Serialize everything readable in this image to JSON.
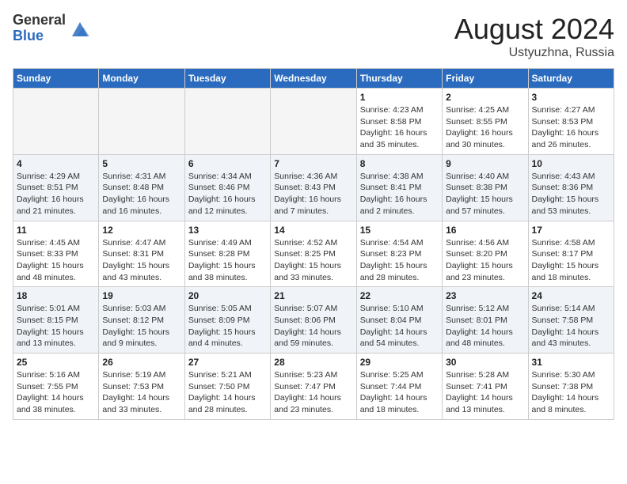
{
  "header": {
    "logo_general": "General",
    "logo_blue": "Blue",
    "month_year": "August 2024",
    "location": "Ustyuzhna, Russia"
  },
  "weekdays": [
    "Sunday",
    "Monday",
    "Tuesday",
    "Wednesday",
    "Thursday",
    "Friday",
    "Saturday"
  ],
  "weeks": [
    [
      {
        "day": "",
        "sunrise": "",
        "sunset": "",
        "daylight": ""
      },
      {
        "day": "",
        "sunrise": "",
        "sunset": "",
        "daylight": ""
      },
      {
        "day": "",
        "sunrise": "",
        "sunset": "",
        "daylight": ""
      },
      {
        "day": "",
        "sunrise": "",
        "sunset": "",
        "daylight": ""
      },
      {
        "day": "1",
        "sunrise": "Sunrise: 4:23 AM",
        "sunset": "Sunset: 8:58 PM",
        "daylight": "Daylight: 16 hours and 35 minutes."
      },
      {
        "day": "2",
        "sunrise": "Sunrise: 4:25 AM",
        "sunset": "Sunset: 8:55 PM",
        "daylight": "Daylight: 16 hours and 30 minutes."
      },
      {
        "day": "3",
        "sunrise": "Sunrise: 4:27 AM",
        "sunset": "Sunset: 8:53 PM",
        "daylight": "Daylight: 16 hours and 26 minutes."
      }
    ],
    [
      {
        "day": "4",
        "sunrise": "Sunrise: 4:29 AM",
        "sunset": "Sunset: 8:51 PM",
        "daylight": "Daylight: 16 hours and 21 minutes."
      },
      {
        "day": "5",
        "sunrise": "Sunrise: 4:31 AM",
        "sunset": "Sunset: 8:48 PM",
        "daylight": "Daylight: 16 hours and 16 minutes."
      },
      {
        "day": "6",
        "sunrise": "Sunrise: 4:34 AM",
        "sunset": "Sunset: 8:46 PM",
        "daylight": "Daylight: 16 hours and 12 minutes."
      },
      {
        "day": "7",
        "sunrise": "Sunrise: 4:36 AM",
        "sunset": "Sunset: 8:43 PM",
        "daylight": "Daylight: 16 hours and 7 minutes."
      },
      {
        "day": "8",
        "sunrise": "Sunrise: 4:38 AM",
        "sunset": "Sunset: 8:41 PM",
        "daylight": "Daylight: 16 hours and 2 minutes."
      },
      {
        "day": "9",
        "sunrise": "Sunrise: 4:40 AM",
        "sunset": "Sunset: 8:38 PM",
        "daylight": "Daylight: 15 hours and 57 minutes."
      },
      {
        "day": "10",
        "sunrise": "Sunrise: 4:43 AM",
        "sunset": "Sunset: 8:36 PM",
        "daylight": "Daylight: 15 hours and 53 minutes."
      }
    ],
    [
      {
        "day": "11",
        "sunrise": "Sunrise: 4:45 AM",
        "sunset": "Sunset: 8:33 PM",
        "daylight": "Daylight: 15 hours and 48 minutes."
      },
      {
        "day": "12",
        "sunrise": "Sunrise: 4:47 AM",
        "sunset": "Sunset: 8:31 PM",
        "daylight": "Daylight: 15 hours and 43 minutes."
      },
      {
        "day": "13",
        "sunrise": "Sunrise: 4:49 AM",
        "sunset": "Sunset: 8:28 PM",
        "daylight": "Daylight: 15 hours and 38 minutes."
      },
      {
        "day": "14",
        "sunrise": "Sunrise: 4:52 AM",
        "sunset": "Sunset: 8:25 PM",
        "daylight": "Daylight: 15 hours and 33 minutes."
      },
      {
        "day": "15",
        "sunrise": "Sunrise: 4:54 AM",
        "sunset": "Sunset: 8:23 PM",
        "daylight": "Daylight: 15 hours and 28 minutes."
      },
      {
        "day": "16",
        "sunrise": "Sunrise: 4:56 AM",
        "sunset": "Sunset: 8:20 PM",
        "daylight": "Daylight: 15 hours and 23 minutes."
      },
      {
        "day": "17",
        "sunrise": "Sunrise: 4:58 AM",
        "sunset": "Sunset: 8:17 PM",
        "daylight": "Daylight: 15 hours and 18 minutes."
      }
    ],
    [
      {
        "day": "18",
        "sunrise": "Sunrise: 5:01 AM",
        "sunset": "Sunset: 8:15 PM",
        "daylight": "Daylight: 15 hours and 13 minutes."
      },
      {
        "day": "19",
        "sunrise": "Sunrise: 5:03 AM",
        "sunset": "Sunset: 8:12 PM",
        "daylight": "Daylight: 15 hours and 9 minutes."
      },
      {
        "day": "20",
        "sunrise": "Sunrise: 5:05 AM",
        "sunset": "Sunset: 8:09 PM",
        "daylight": "Daylight: 15 hours and 4 minutes."
      },
      {
        "day": "21",
        "sunrise": "Sunrise: 5:07 AM",
        "sunset": "Sunset: 8:06 PM",
        "daylight": "Daylight: 14 hours and 59 minutes."
      },
      {
        "day": "22",
        "sunrise": "Sunrise: 5:10 AM",
        "sunset": "Sunset: 8:04 PM",
        "daylight": "Daylight: 14 hours and 54 minutes."
      },
      {
        "day": "23",
        "sunrise": "Sunrise: 5:12 AM",
        "sunset": "Sunset: 8:01 PM",
        "daylight": "Daylight: 14 hours and 48 minutes."
      },
      {
        "day": "24",
        "sunrise": "Sunrise: 5:14 AM",
        "sunset": "Sunset: 7:58 PM",
        "daylight": "Daylight: 14 hours and 43 minutes."
      }
    ],
    [
      {
        "day": "25",
        "sunrise": "Sunrise: 5:16 AM",
        "sunset": "Sunset: 7:55 PM",
        "daylight": "Daylight: 14 hours and 38 minutes."
      },
      {
        "day": "26",
        "sunrise": "Sunrise: 5:19 AM",
        "sunset": "Sunset: 7:53 PM",
        "daylight": "Daylight: 14 hours and 33 minutes."
      },
      {
        "day": "27",
        "sunrise": "Sunrise: 5:21 AM",
        "sunset": "Sunset: 7:50 PM",
        "daylight": "Daylight: 14 hours and 28 minutes."
      },
      {
        "day": "28",
        "sunrise": "Sunrise: 5:23 AM",
        "sunset": "Sunset: 7:47 PM",
        "daylight": "Daylight: 14 hours and 23 minutes."
      },
      {
        "day": "29",
        "sunrise": "Sunrise: 5:25 AM",
        "sunset": "Sunset: 7:44 PM",
        "daylight": "Daylight: 14 hours and 18 minutes."
      },
      {
        "day": "30",
        "sunrise": "Sunrise: 5:28 AM",
        "sunset": "Sunset: 7:41 PM",
        "daylight": "Daylight: 14 hours and 13 minutes."
      },
      {
        "day": "31",
        "sunrise": "Sunrise: 5:30 AM",
        "sunset": "Sunset: 7:38 PM",
        "daylight": "Daylight: 14 hours and 8 minutes."
      }
    ]
  ]
}
